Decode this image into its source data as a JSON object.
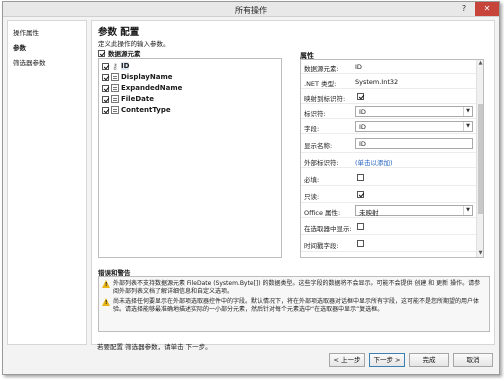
{
  "window": {
    "title": "所有操作",
    "help": "?",
    "close": "✕"
  },
  "nav": {
    "items": [
      {
        "label": "操作属性"
      },
      {
        "label": "参数"
      },
      {
        "label": "筛选器参数"
      }
    ]
  },
  "main": {
    "title": "参数 配置",
    "description": "定义此操作的输入参数。"
  },
  "tree": {
    "header": "数据源元素",
    "items": [
      {
        "label": "ID",
        "checked": true,
        "icon": "key-icon"
      },
      {
        "label": "DisplayName",
        "checked": true,
        "icon": "field-icon"
      },
      {
        "label": "ExpandedName",
        "checked": true,
        "icon": "field-icon"
      },
      {
        "label": "FileDate",
        "checked": true,
        "icon": "field-icon"
      },
      {
        "label": "ContentType",
        "checked": true,
        "icon": "field-icon"
      }
    ]
  },
  "properties": {
    "title": "属性",
    "rows": [
      {
        "label": "数据源元素:",
        "value": "ID"
      },
      {
        "label": ".NET 类型:",
        "value": "System.Int32"
      },
      {
        "label": "映射到标识符:",
        "checked": true
      },
      {
        "label": "标识符:",
        "combo": "ID"
      },
      {
        "label": "字段:",
        "combo": "ID"
      },
      {
        "label": "显示名称:",
        "text": "ID"
      },
      {
        "label": "外部标识符:",
        "link": "(单击以添加)"
      },
      {
        "label": "必填:",
        "checked": false
      },
      {
        "label": "只读:",
        "checked": true
      },
      {
        "label": "Office 属性:",
        "combo": "未映射"
      },
      {
        "label": "在选取器中显示:",
        "checked": false
      },
      {
        "label": "时间戳字段:",
        "checked": false
      }
    ]
  },
  "errors": {
    "title": "错误和警告",
    "items": [
      {
        "text": "外部列表不支持数据源元素 FileDate (System.Byte[]) 的数据类型。这些字段的数据将不会显示。可能不会提供 创建 和 更新 操作。请参阅外部列表文档了解详细信息和自定义选项。"
      },
      {
        "text": "尚未选择任何要显示在外部项选取器控件中的字段。默认情况下，将在外部项选取器对话框中显示所有字段，这可能不是您所期望的用户体验。请选择能够最准确地描述实际的一小部分元素，然后针对每个元素选中“在选取器中显示”复选框。"
      }
    ]
  },
  "footer": {
    "hint": "若要配置 筛选器参数，请单击 下一步。",
    "back": "< 上一步",
    "next": "下一步 >",
    "finish": "完成",
    "cancel": "取消"
  },
  "colors": {
    "close_button": "#c7443a",
    "link": "#1f5fbf",
    "warning": "#e8b51a"
  }
}
